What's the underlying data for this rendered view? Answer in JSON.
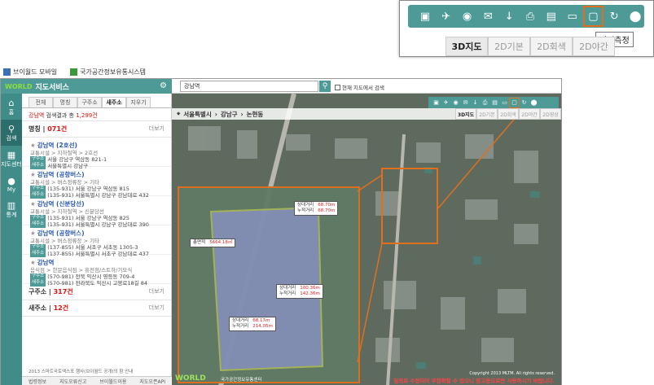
{
  "zoom": {
    "toolbar_icons": [
      "map-icon",
      "satellite-icon",
      "roadview-icon",
      "mail-icon",
      "download-icon",
      "print-icon",
      "grid-icon",
      "ruler-icon",
      "area-measure-icon",
      "refresh-icon",
      "location-pin-icon"
    ],
    "tooltip": "면적측정",
    "tabs": [
      "3D지도",
      "2D기본",
      "2D회색",
      "2D야간",
      "2D영상"
    ]
  },
  "browser_tabs": [
    "브이월드 모바일",
    "국가공간정보유통시스템"
  ],
  "left": {
    "logo": "WORLD",
    "title": "지도서비스",
    "iconbar": [
      {
        "label": "홈",
        "icon": "home-icon"
      },
      {
        "label": "검색",
        "icon": "search-icon"
      },
      {
        "label": "지도센터",
        "icon": "map-center-icon"
      },
      {
        "label": "My",
        "icon": "my-icon"
      },
      {
        "label": "통계",
        "icon": "stats-icon"
      }
    ],
    "tabs": [
      "전체",
      "명칭",
      "구주소",
      "새주소",
      "지우기"
    ],
    "summary_prefix": "강남역",
    "summary_text": " 검색결과 총 ",
    "summary_count": "1,299건",
    "section1_label": "명칭",
    "section1_count": "071건",
    "more": "더보기",
    "items": [
      {
        "title": "강남역 (2호선)",
        "cat": "교통시설 > 지하철역 > 2호선",
        "a1_tag": "구주소",
        "a1": "서울 강남구 역삼동 821-1",
        "a2_tag": "새주소",
        "a2": "서울특별시 강남구"
      },
      {
        "title": "강남역 (공항버스)",
        "cat": "교통시설 > 버스정류장 > 기타",
        "a1_tag": "구주소",
        "a1": "(135-931) 서울 강남구 역삼동 815",
        "a2_tag": "새주소",
        "a2": "(135-931) 서울특별시 강남구 강남대로 432"
      },
      {
        "title": "강남역 (신분당선)",
        "cat": "교통시설 > 지하철역 > 신분당선",
        "a1_tag": "구주소",
        "a1": "(135-931) 서울 강남구 역삼동 825",
        "a2_tag": "새주소",
        "a2": "(135-931) 서울특별시 강남구 강남대로 390"
      },
      {
        "title": "강남역 (공항버스)",
        "cat": "교통시설 > 버스정류장 > 기타",
        "a1_tag": "구주소",
        "a1": "(137-855) 서울 서초구 서초동 1305-3",
        "a2_tag": "새주소",
        "a2": "(137-855) 서울특별시 서초구 강남대로 437"
      },
      {
        "title": "강남역",
        "cat": "음식점 > 한문음식점 > 휴전점/스트하/기모식",
        "a1_tag": "구주소",
        "a1": "(570-981) 전북 익산시 영등동 709-4",
        "a2_tag": "새주소",
        "a2": "(570-981) 전라북도 익산시 고봉로18길 84"
      }
    ],
    "section2_label": "구주소",
    "section2_count": "317건",
    "section3_label": "새주소",
    "section3_count": "12건",
    "notice": "2013 스마트국토엑스포 행사(브이월드 공개)의 참 안내",
    "bottom_links": [
      "법령정보",
      "지도오류신고",
      "브이월드이용",
      "지도오픈API"
    ]
  },
  "search": {
    "value": "강남역",
    "checkbox_label": "현재 지도에서 검색"
  },
  "map": {
    "toolbar_icons": [
      "map-icon",
      "satellite-icon",
      "roadview-icon",
      "mail-icon",
      "download-icon",
      "print-icon",
      "grid-icon",
      "ruler-icon",
      "area-measure-icon",
      "refresh-icon",
      "location-pin-icon"
    ],
    "address": [
      "서울특별시",
      "강남구",
      "논현동"
    ],
    "tabs": [
      "3D지도",
      "2D기본",
      "2D회색",
      "2D야간",
      "2D영상"
    ],
    "measurements": [
      {
        "l1": "상대거리",
        "v1": "68.70m",
        "l2": "누적거리",
        "v2": "68.70m"
      },
      {
        "l1": "총면적",
        "v1": "5664.18㎡"
      },
      {
        "l1": "상대거리",
        "v1": "100.36m",
        "l2": "누적거리",
        "v2": "142.36m"
      },
      {
        "l1": "상대거리",
        "v1": "68.17m",
        "l2": "누적거리",
        "v2": "214.05m"
      }
    ],
    "logo": "WORLD",
    "footer": "국가공간정보유통센터",
    "warning": "임의로 수정되어 부정확할 수 있으니 참고용으로만 사용하시기 바랍니다.",
    "copyright": "Copyright 2013 MLTM. All rights reserved."
  }
}
